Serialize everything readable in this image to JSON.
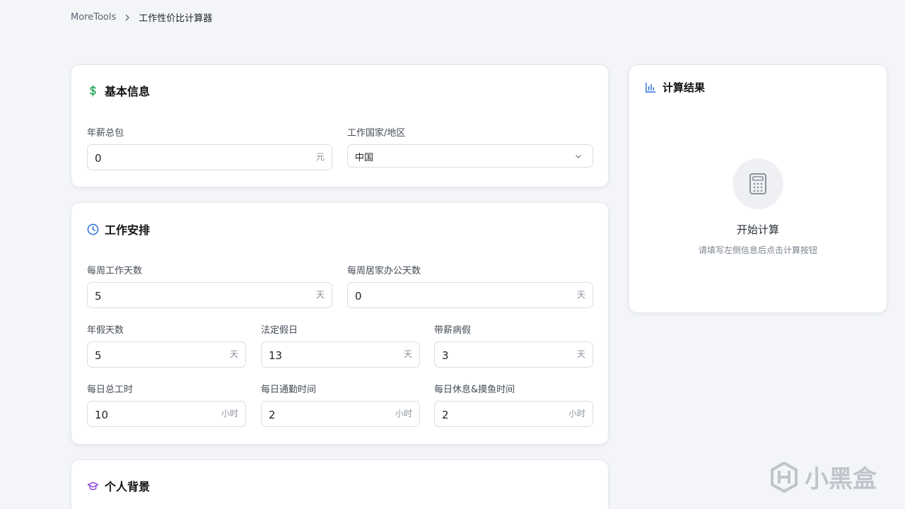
{
  "breadcrumb": {
    "home": "MoreTools",
    "current": "工作性价比计算器"
  },
  "basic_info": {
    "title": "基本信息",
    "salary": {
      "label": "年薪总包",
      "value": "0",
      "unit": "元"
    },
    "country": {
      "label": "工作国家/地区",
      "value": "中国"
    }
  },
  "work": {
    "title": "工作安排",
    "days_per_week": {
      "label": "每周工作天数",
      "value": "5",
      "unit": "天"
    },
    "wfh_days": {
      "label": "每周居家办公天数",
      "value": "0",
      "unit": "天"
    },
    "annual_leave": {
      "label": "年假天数",
      "value": "5",
      "unit": "天"
    },
    "holidays": {
      "label": "法定假日",
      "value": "13",
      "unit": "天"
    },
    "sick_leave": {
      "label": "带薪病假",
      "value": "3",
      "unit": "天"
    },
    "hours": {
      "label": "每日总工时",
      "value": "10",
      "unit": "小时"
    },
    "commute": {
      "label": "每日通勤时间",
      "value": "2",
      "unit": "小时"
    },
    "rest": {
      "label": "每日休息&摸鱼时间",
      "value": "2",
      "unit": "小时"
    }
  },
  "background": {
    "title": "个人背景"
  },
  "result": {
    "title": "计算结果",
    "empty_title": "开始计算",
    "empty_desc": "请填写左侧信息后点击计算按钮"
  },
  "watermark": "小黑盒",
  "colors": {
    "green": "#22a55a",
    "blue": "#2f6fde",
    "purple": "#8b3fe0"
  }
}
